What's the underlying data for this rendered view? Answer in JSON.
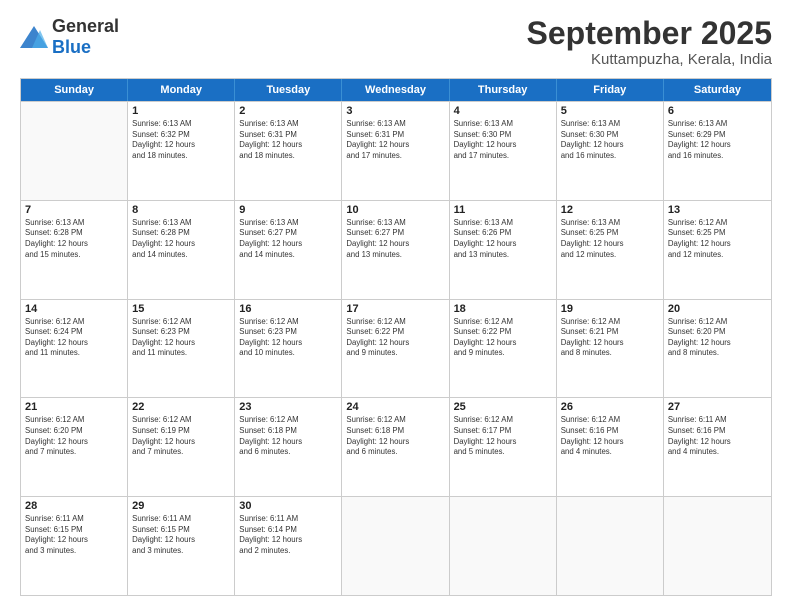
{
  "logo": {
    "general": "General",
    "blue": "Blue"
  },
  "title": "September 2025",
  "location": "Kuttampuzha, Kerala, India",
  "header_days": [
    "Sunday",
    "Monday",
    "Tuesday",
    "Wednesday",
    "Thursday",
    "Friday",
    "Saturday"
  ],
  "weeks": [
    [
      {
        "day": "",
        "info": ""
      },
      {
        "day": "1",
        "info": "Sunrise: 6:13 AM\nSunset: 6:32 PM\nDaylight: 12 hours\nand 18 minutes."
      },
      {
        "day": "2",
        "info": "Sunrise: 6:13 AM\nSunset: 6:31 PM\nDaylight: 12 hours\nand 18 minutes."
      },
      {
        "day": "3",
        "info": "Sunrise: 6:13 AM\nSunset: 6:31 PM\nDaylight: 12 hours\nand 17 minutes."
      },
      {
        "day": "4",
        "info": "Sunrise: 6:13 AM\nSunset: 6:30 PM\nDaylight: 12 hours\nand 17 minutes."
      },
      {
        "day": "5",
        "info": "Sunrise: 6:13 AM\nSunset: 6:30 PM\nDaylight: 12 hours\nand 16 minutes."
      },
      {
        "day": "6",
        "info": "Sunrise: 6:13 AM\nSunset: 6:29 PM\nDaylight: 12 hours\nand 16 minutes."
      }
    ],
    [
      {
        "day": "7",
        "info": "Sunrise: 6:13 AM\nSunset: 6:28 PM\nDaylight: 12 hours\nand 15 minutes."
      },
      {
        "day": "8",
        "info": "Sunrise: 6:13 AM\nSunset: 6:28 PM\nDaylight: 12 hours\nand 14 minutes."
      },
      {
        "day": "9",
        "info": "Sunrise: 6:13 AM\nSunset: 6:27 PM\nDaylight: 12 hours\nand 14 minutes."
      },
      {
        "day": "10",
        "info": "Sunrise: 6:13 AM\nSunset: 6:27 PM\nDaylight: 12 hours\nand 13 minutes."
      },
      {
        "day": "11",
        "info": "Sunrise: 6:13 AM\nSunset: 6:26 PM\nDaylight: 12 hours\nand 13 minutes."
      },
      {
        "day": "12",
        "info": "Sunrise: 6:13 AM\nSunset: 6:25 PM\nDaylight: 12 hours\nand 12 minutes."
      },
      {
        "day": "13",
        "info": "Sunrise: 6:12 AM\nSunset: 6:25 PM\nDaylight: 12 hours\nand 12 minutes."
      }
    ],
    [
      {
        "day": "14",
        "info": "Sunrise: 6:12 AM\nSunset: 6:24 PM\nDaylight: 12 hours\nand 11 minutes."
      },
      {
        "day": "15",
        "info": "Sunrise: 6:12 AM\nSunset: 6:23 PM\nDaylight: 12 hours\nand 11 minutes."
      },
      {
        "day": "16",
        "info": "Sunrise: 6:12 AM\nSunset: 6:23 PM\nDaylight: 12 hours\nand 10 minutes."
      },
      {
        "day": "17",
        "info": "Sunrise: 6:12 AM\nSunset: 6:22 PM\nDaylight: 12 hours\nand 9 minutes."
      },
      {
        "day": "18",
        "info": "Sunrise: 6:12 AM\nSunset: 6:22 PM\nDaylight: 12 hours\nand 9 minutes."
      },
      {
        "day": "19",
        "info": "Sunrise: 6:12 AM\nSunset: 6:21 PM\nDaylight: 12 hours\nand 8 minutes."
      },
      {
        "day": "20",
        "info": "Sunrise: 6:12 AM\nSunset: 6:20 PM\nDaylight: 12 hours\nand 8 minutes."
      }
    ],
    [
      {
        "day": "21",
        "info": "Sunrise: 6:12 AM\nSunset: 6:20 PM\nDaylight: 12 hours\nand 7 minutes."
      },
      {
        "day": "22",
        "info": "Sunrise: 6:12 AM\nSunset: 6:19 PM\nDaylight: 12 hours\nand 7 minutes."
      },
      {
        "day": "23",
        "info": "Sunrise: 6:12 AM\nSunset: 6:18 PM\nDaylight: 12 hours\nand 6 minutes."
      },
      {
        "day": "24",
        "info": "Sunrise: 6:12 AM\nSunset: 6:18 PM\nDaylight: 12 hours\nand 6 minutes."
      },
      {
        "day": "25",
        "info": "Sunrise: 6:12 AM\nSunset: 6:17 PM\nDaylight: 12 hours\nand 5 minutes."
      },
      {
        "day": "26",
        "info": "Sunrise: 6:12 AM\nSunset: 6:16 PM\nDaylight: 12 hours\nand 4 minutes."
      },
      {
        "day": "27",
        "info": "Sunrise: 6:11 AM\nSunset: 6:16 PM\nDaylight: 12 hours\nand 4 minutes."
      }
    ],
    [
      {
        "day": "28",
        "info": "Sunrise: 6:11 AM\nSunset: 6:15 PM\nDaylight: 12 hours\nand 3 minutes."
      },
      {
        "day": "29",
        "info": "Sunrise: 6:11 AM\nSunset: 6:15 PM\nDaylight: 12 hours\nand 3 minutes."
      },
      {
        "day": "30",
        "info": "Sunrise: 6:11 AM\nSunset: 6:14 PM\nDaylight: 12 hours\nand 2 minutes."
      },
      {
        "day": "",
        "info": ""
      },
      {
        "day": "",
        "info": ""
      },
      {
        "day": "",
        "info": ""
      },
      {
        "day": "",
        "info": ""
      }
    ]
  ]
}
